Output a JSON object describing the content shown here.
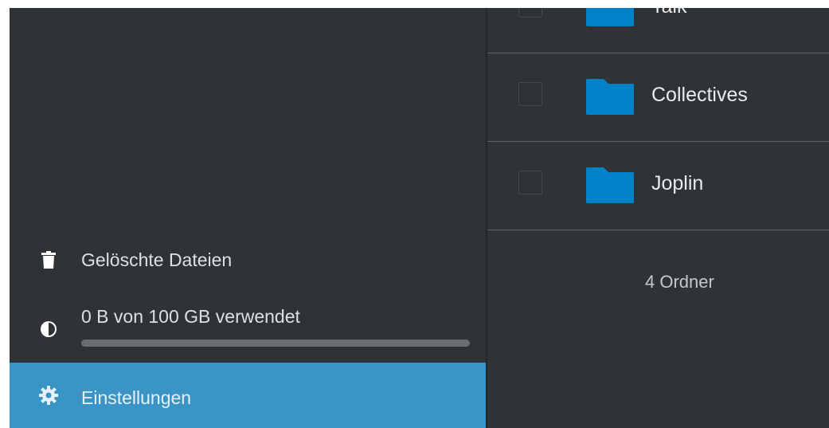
{
  "sidebar": {
    "trash_label": "Gelöschte Dateien",
    "quota_label": "0 B von 100 GB verwendet",
    "quota_fraction": 0,
    "settings_label": "Einstellungen"
  },
  "files": {
    "rows": [
      {
        "name": "Talk"
      },
      {
        "name": "Collectives"
      },
      {
        "name": "Joplin"
      }
    ],
    "summary": "4 Ordner"
  },
  "colors": {
    "background": "#303336",
    "accent": "#0082c9",
    "settings_highlight": "#3a94c6"
  },
  "icons": {
    "trash": "trash-icon",
    "quota": "quota-pie-icon",
    "settings": "gear-icon",
    "folder": "folder-icon"
  }
}
